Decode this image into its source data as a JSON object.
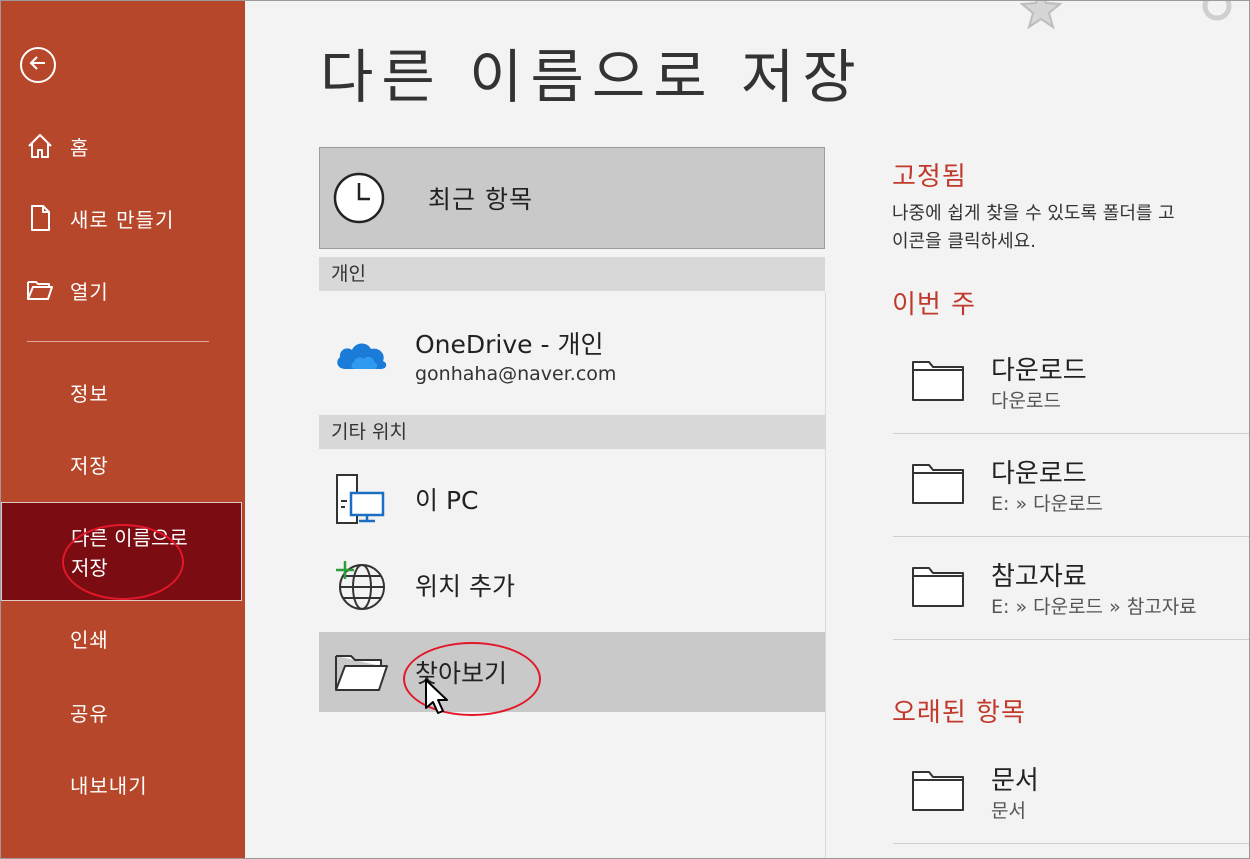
{
  "sidebar": {
    "back_icon": "back-arrow-icon",
    "items": [
      {
        "label": "홈",
        "icon": "home-icon"
      },
      {
        "label": "새로 만들기",
        "icon": "new-document-icon"
      },
      {
        "label": "열기",
        "icon": "folder-open-icon"
      },
      {
        "label": "정보"
      },
      {
        "label": "저장"
      },
      {
        "label": "다른 이름으로\n저장",
        "selected": true
      },
      {
        "label": "인쇄"
      },
      {
        "label": "공유"
      },
      {
        "label": "내보내기"
      }
    ],
    "accent_color": "#b7472a",
    "selected_color": "#7a0c12"
  },
  "main": {
    "title": "다른 이름으로 저장",
    "locations": {
      "recent": {
        "label": "최근 항목",
        "icon": "clock-icon"
      },
      "personal_header": "개인",
      "onedrive": {
        "name": "OneDrive - 개인",
        "email": "gonhaha@naver.com",
        "icon": "cloud-icon"
      },
      "other_header": "기타 위치",
      "this_pc": {
        "label": "이 PC",
        "icon": "computer-icon"
      },
      "add_location": {
        "label": "위치 추가",
        "icon": "globe-add-icon"
      },
      "browse": {
        "label": "찾아보기",
        "icon": "folder-open-icon"
      }
    }
  },
  "right_pane": {
    "pinned": {
      "title": "고정됨",
      "desc_line1": "나중에 쉽게 찾을 수 있도록 폴더를 고",
      "desc_line2": "이콘을 클릭하세요."
    },
    "this_week": {
      "title": "이번 주",
      "folders": [
        {
          "name": "다운로드",
          "path": "다운로드"
        },
        {
          "name": "다운로드",
          "path": "E: » 다운로드"
        },
        {
          "name": "참고자료",
          "path": "E: » 다운로드 » 참고자료"
        }
      ]
    },
    "older": {
      "title": "오래된 항목",
      "folders": [
        {
          "name": "문서",
          "path": "문서"
        }
      ]
    },
    "accent_color": "#c0392b"
  }
}
